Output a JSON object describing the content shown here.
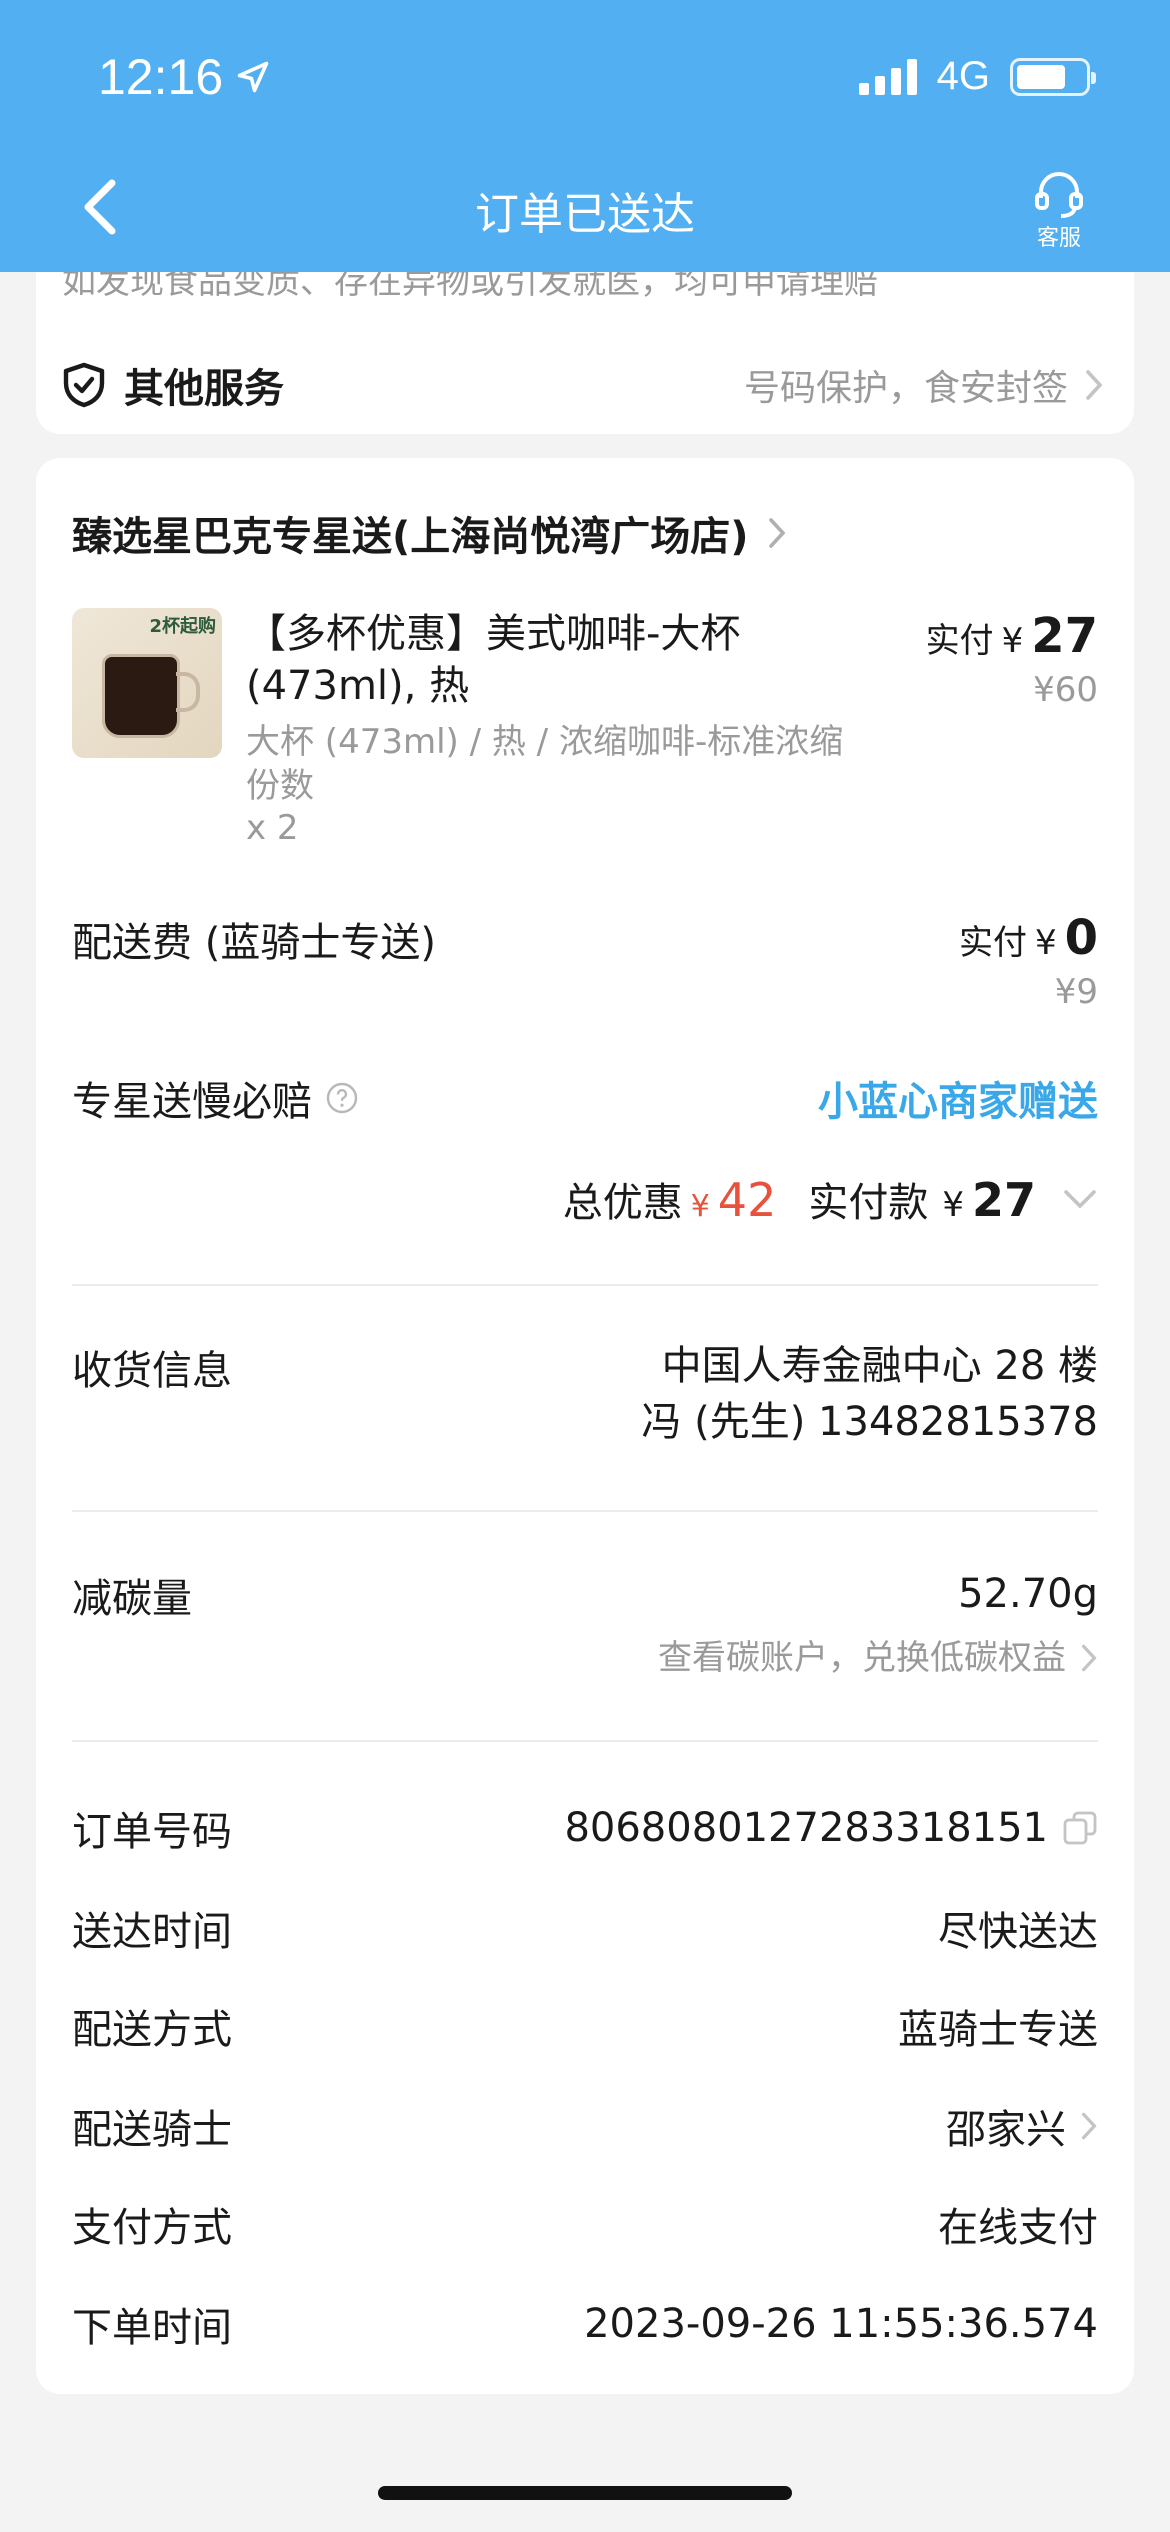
{
  "status_bar": {
    "time": "12:16",
    "network": "4G"
  },
  "nav": {
    "title": "订单已送达",
    "service_label": "客服"
  },
  "service_card": {
    "truncated_text": "如发现食品变质、存在异物或引发就医，均可申请理赔",
    "title": "其他服务",
    "detail": "号码保护，食安封签"
  },
  "store": {
    "name": "臻选星巴克专星送(上海尚悦湾广场店)"
  },
  "product": {
    "thumb_tag": "2杯起购",
    "name": "【多杯优惠】美式咖啡-大杯(473ml), 热",
    "spec": "大杯 (473ml) / 热 / 浓缩咖啡-标准浓缩份数",
    "qty": "x 2",
    "paid_label": "实付",
    "currency": "¥",
    "paid_price": "27",
    "original_price": "¥60"
  },
  "delivery_fee": {
    "label": "配送费 (蓝骑士专送)",
    "paid_label": "实付",
    "currency": "¥",
    "paid_price": "0",
    "original_price": "¥9"
  },
  "compensation": {
    "label": "专星送慢必赔",
    "value": "小蓝心商家赠送"
  },
  "totals": {
    "discount_label": "总优惠",
    "discount_currency": "¥",
    "discount": "42",
    "actual_label": "实付款",
    "actual_currency": "¥",
    "actual": "27"
  },
  "receiver": {
    "label": "收货信息",
    "address": "中国人寿金融中心 28 楼",
    "contact": "冯 (先生) 13482815378"
  },
  "carbon": {
    "label": "减碳量",
    "value": "52.70g",
    "link": "查看碳账户，兑换低碳权益"
  },
  "details": [
    {
      "label": "订单号码",
      "value": "8068080127283318151"
    },
    {
      "label": "送达时间",
      "value": "尽快送达"
    },
    {
      "label": "配送方式",
      "value": "蓝骑士专送"
    },
    {
      "label": "配送骑士",
      "value": "邵家兴"
    },
    {
      "label": "支付方式",
      "value": "在线支付"
    },
    {
      "label": "下单时间",
      "value": "2023-09-26 11:55:36.574"
    }
  ],
  "colors": {
    "header": "#52aff2",
    "accent": "#3aa7e8",
    "discount": "#e8513c"
  }
}
